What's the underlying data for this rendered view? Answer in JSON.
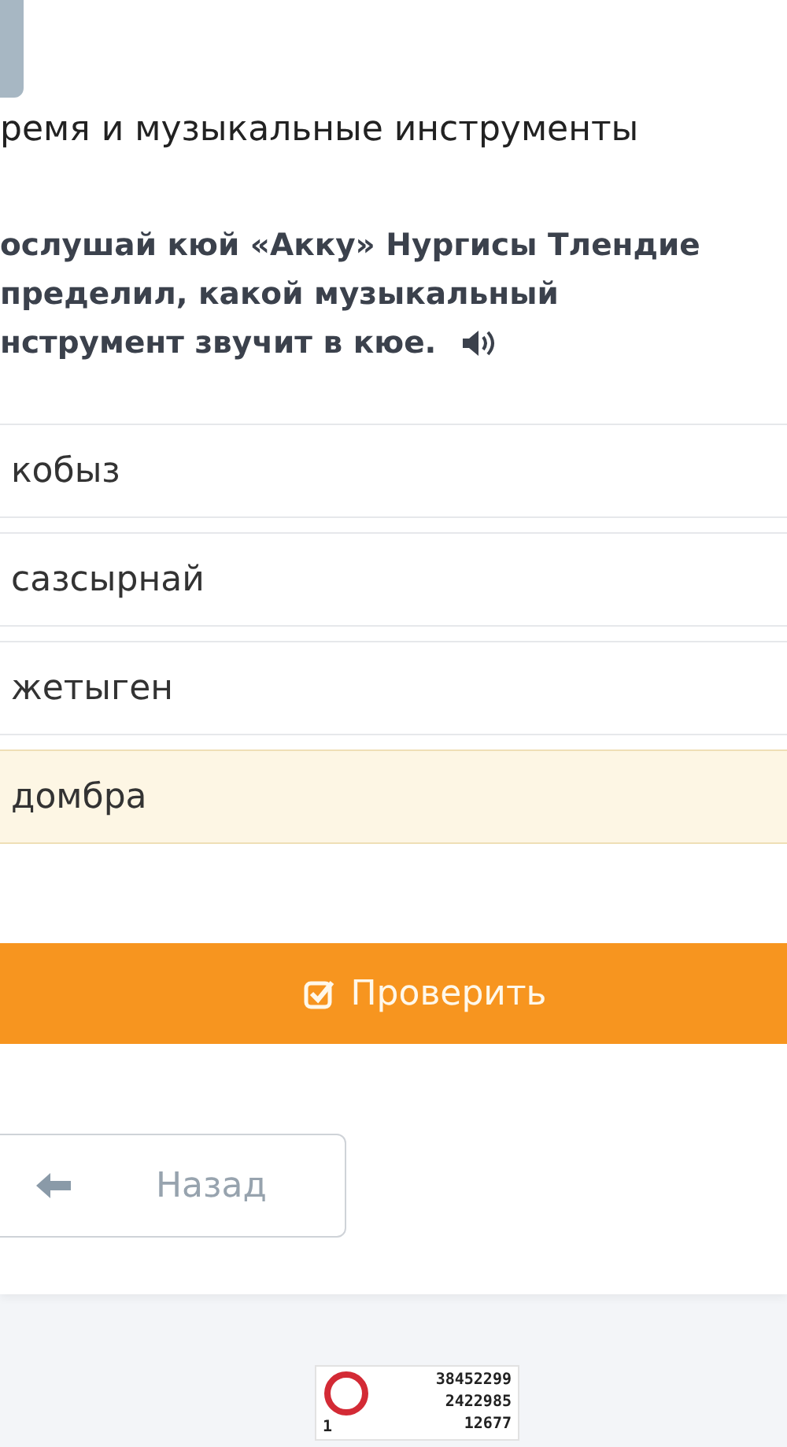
{
  "topic": "ремя и музыкальные инструменты",
  "question": {
    "lines": [
      "ослушай кюй «Акку» Нургисы Тлендие",
      "пределил, какой музыкальный",
      "нструмент звучит в кюе."
    ]
  },
  "options": [
    {
      "label": "кобыз",
      "selected": false
    },
    {
      "label": "сазсырнай",
      "selected": false
    },
    {
      "label": "жетыген",
      "selected": false
    },
    {
      "label": "домбра",
      "selected": true
    }
  ],
  "check_button": "Проверить",
  "back_button": "Назад",
  "counter": {
    "lines": [
      "38452299",
      "2422985",
      "12677"
    ],
    "corner": "1"
  }
}
